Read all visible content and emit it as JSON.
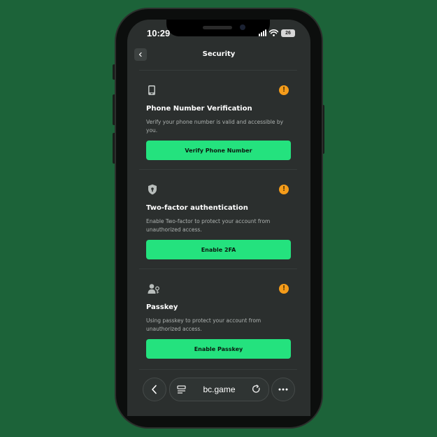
{
  "status_bar": {
    "time": "10:29",
    "battery": "26"
  },
  "header": {
    "title": "Security",
    "back_icon": "chevron-left-icon"
  },
  "sections": [
    {
      "icon": "phone-icon",
      "warning_icon": "warning-icon",
      "warning_symbol": "!",
      "title": "Phone Number Verification",
      "description": "Verify your phone number is valid and accessible by you.",
      "button_label": "Verify Phone Number"
    },
    {
      "icon": "shield-icon",
      "warning_icon": "warning-icon",
      "warning_symbol": "!",
      "title": "Two-factor authentication",
      "description": "Enable Two-factor to protect your account from unauthorized access.",
      "button_label": "Enable 2FA"
    },
    {
      "icon": "passkey-icon",
      "warning_icon": "warning-icon",
      "warning_symbol": "!",
      "title": "Passkey",
      "description": "Using passkey to protect your account from unauthorized access.",
      "button_label": "Enable Passkey"
    }
  ],
  "browser_bar": {
    "url": "bc.game",
    "back_icon": "chevron-left-icon",
    "tabs_icon": "tabs-icon",
    "reload_icon": "reload-icon",
    "more_icon": "more-icon"
  },
  "colors": {
    "background": "#1c6339",
    "accent": "#24e27e",
    "warning": "#f59c1a",
    "surface": "#2b2f2e"
  }
}
